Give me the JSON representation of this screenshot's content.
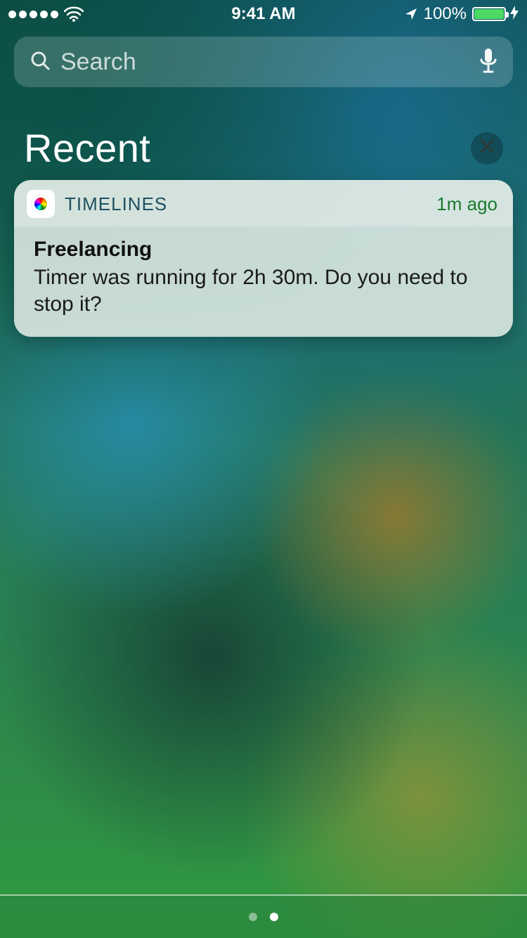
{
  "status": {
    "signal_dots": 5,
    "time": "9:41 AM",
    "battery_pct": "100%"
  },
  "search": {
    "placeholder": "Search"
  },
  "section": {
    "title": "Recent"
  },
  "notification": {
    "app_name": "TIMELINES",
    "time_ago": "1m ago",
    "title": "Freelancing",
    "body": "Timer was running for 2h 30m. Do you need to stop it?"
  },
  "pager": {
    "count": 2,
    "active_index": 1
  }
}
